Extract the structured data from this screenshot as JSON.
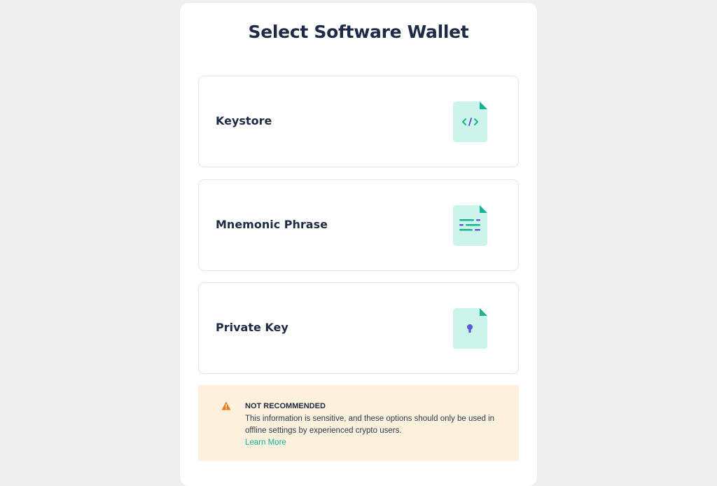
{
  "title": "Select Software Wallet",
  "options": [
    {
      "label": "Keystore",
      "icon": "keystore-file-icon"
    },
    {
      "label": "Mnemonic Phrase",
      "icon": "mnemonic-file-icon"
    },
    {
      "label": "Private Key",
      "icon": "private-key-file-icon"
    }
  ],
  "warning": {
    "icon": "warning-icon",
    "title": "NOT RECOMMENDED",
    "text": "This information is sensitive, and these options should only be used in offline settings by experienced crypto users.",
    "link": "Learn More"
  },
  "colors": {
    "accent": "#19b394",
    "icon_bg": "#cdf4ea",
    "icon_purple": "#5b5bd6",
    "warning_bg": "#fdf0dc",
    "warning_icon": "#f07b1a",
    "title": "#1f2a44"
  }
}
